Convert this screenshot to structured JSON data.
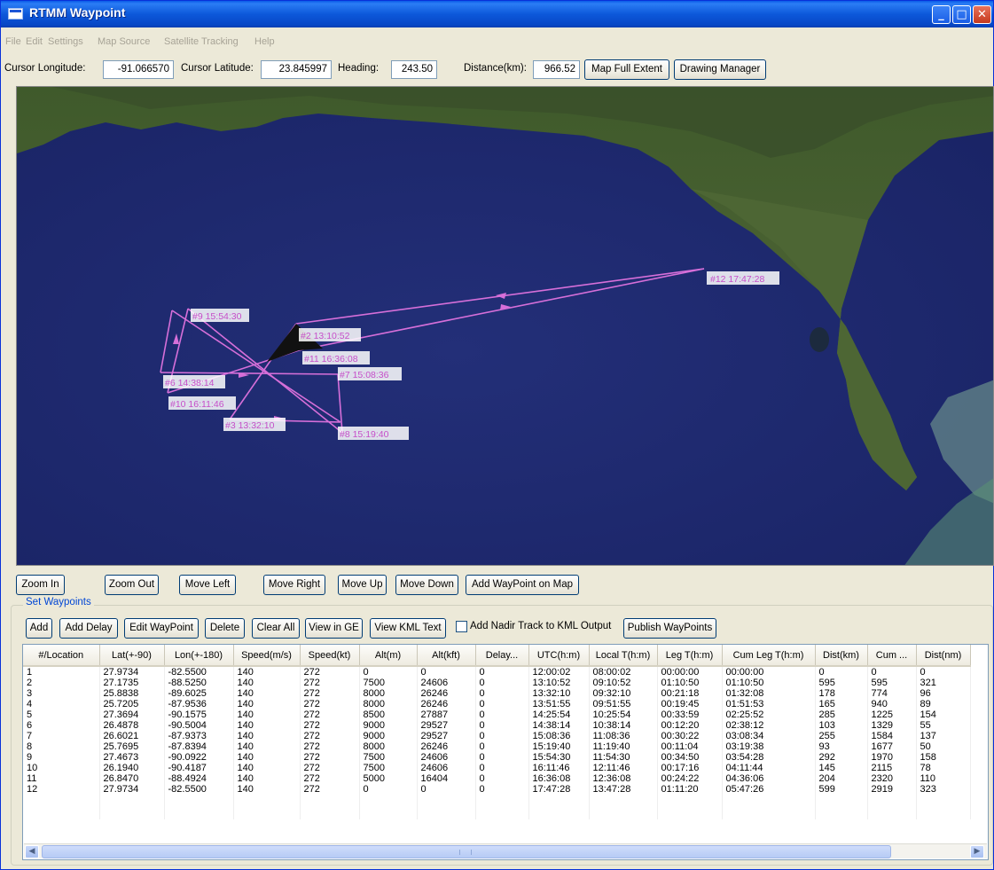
{
  "window": {
    "title": "RTMM Waypoint"
  },
  "menu": [
    "File",
    "Edit",
    "Settings",
    "Map Source",
    "Satellite Tracking",
    "Help"
  ],
  "toolbar": {
    "cursor_lon_label": "Cursor Longitude:",
    "cursor_lon_value": "-91.066570",
    "cursor_lat_label": "Cursor Latitude:",
    "cursor_lat_value": "23.845997",
    "heading_label": "Heading:",
    "heading_value": "243.50",
    "distance_label": "Distance(km):",
    "distance_value": "966.52",
    "full_extent_label": "Map Full Extent",
    "drawing_manager_label": "Drawing Manager"
  },
  "map": {
    "waypoint_labels": [
      "#12 17:47:28",
      "#9 15:54:30",
      "#2 13:10:52",
      "#11 16:36:08",
      "#7 15:08:36",
      "#6 14:38:14",
      "#10 16:11:46",
      "#3 13:32:10",
      "#8 15:19:40"
    ],
    "track_color": "#d66fd9"
  },
  "nav_buttons": [
    "Zoom In",
    "Zoom Out",
    "Move Left",
    "Move Right",
    "Move Up",
    "Move Down",
    "Add WayPoint on Map"
  ],
  "waypoints_panel": {
    "title": "Set Waypoints",
    "buttons": [
      "Add",
      "Add Delay",
      "Edit WayPoint",
      "Delete",
      "Clear All",
      "View in GE",
      "View KML Text"
    ],
    "nadir_checkbox_label": "Add Nadir Track to KML Output",
    "nadir_checked": false,
    "publish_label": "Publish WayPoints"
  },
  "table": {
    "columns": [
      "#/Location",
      "Lat(+-90)",
      "Lon(+-180)",
      "Speed(m/s)",
      "Speed(kt)",
      "Alt(m)",
      "Alt(kft)",
      "Delay...",
      "UTC(h:m)",
      "Local T(h:m)",
      "Leg T(h:m)",
      "Cum Leg T(h:m)",
      "Dist(km)",
      "Cum ...",
      "Dist(nm)"
    ],
    "rows": [
      [
        "1",
        "27.9734",
        "-82.5500",
        "140",
        "272",
        "0",
        "0",
        "0",
        "12:00:02",
        "08:00:02",
        "00:00:00",
        "00:00:00",
        "0",
        "0",
        "0"
      ],
      [
        "2",
        "27.1735",
        "-88.5250",
        "140",
        "272",
        "7500",
        "24606",
        "0",
        "13:10:52",
        "09:10:52",
        "01:10:50",
        "01:10:50",
        "595",
        "595",
        "321"
      ],
      [
        "3",
        "25.8838",
        "-89.6025",
        "140",
        "272",
        "8000",
        "26246",
        "0",
        "13:32:10",
        "09:32:10",
        "00:21:18",
        "01:32:08",
        "178",
        "774",
        "96"
      ],
      [
        "4",
        "25.7205",
        "-87.9536",
        "140",
        "272",
        "8000",
        "26246",
        "0",
        "13:51:55",
        "09:51:55",
        "00:19:45",
        "01:51:53",
        "165",
        "940",
        "89"
      ],
      [
        "5",
        "27.3694",
        "-90.1575",
        "140",
        "272",
        "8500",
        "27887",
        "0",
        "14:25:54",
        "10:25:54",
        "00:33:59",
        "02:25:52",
        "285",
        "1225",
        "154"
      ],
      [
        "6",
        "26.4878",
        "-90.5004",
        "140",
        "272",
        "9000",
        "29527",
        "0",
        "14:38:14",
        "10:38:14",
        "00:12:20",
        "02:38:12",
        "103",
        "1329",
        "55"
      ],
      [
        "7",
        "26.6021",
        "-87.9373",
        "140",
        "272",
        "9000",
        "29527",
        "0",
        "15:08:36",
        "11:08:36",
        "00:30:22",
        "03:08:34",
        "255",
        "1584",
        "137"
      ],
      [
        "8",
        "25.7695",
        "-87.8394",
        "140",
        "272",
        "8000",
        "26246",
        "0",
        "15:19:40",
        "11:19:40",
        "00:11:04",
        "03:19:38",
        "93",
        "1677",
        "50"
      ],
      [
        "9",
        "27.4673",
        "-90.0922",
        "140",
        "272",
        "7500",
        "24606",
        "0",
        "15:54:30",
        "11:54:30",
        "00:34:50",
        "03:54:28",
        "292",
        "1970",
        "158"
      ],
      [
        "10",
        "26.1940",
        "-90.4187",
        "140",
        "272",
        "7500",
        "24606",
        "0",
        "16:11:46",
        "12:11:46",
        "00:17:16",
        "04:11:44",
        "145",
        "2115",
        "78"
      ],
      [
        "11",
        "26.8470",
        "-88.4924",
        "140",
        "272",
        "5000",
        "16404",
        "0",
        "16:36:08",
        "12:36:08",
        "00:24:22",
        "04:36:06",
        "204",
        "2320",
        "110"
      ],
      [
        "12",
        "27.9734",
        "-82.5500",
        "140",
        "272",
        "0",
        "0",
        "0",
        "17:47:28",
        "13:47:28",
        "01:11:20",
        "05:47:26",
        "599",
        "2919",
        "323"
      ]
    ]
  }
}
